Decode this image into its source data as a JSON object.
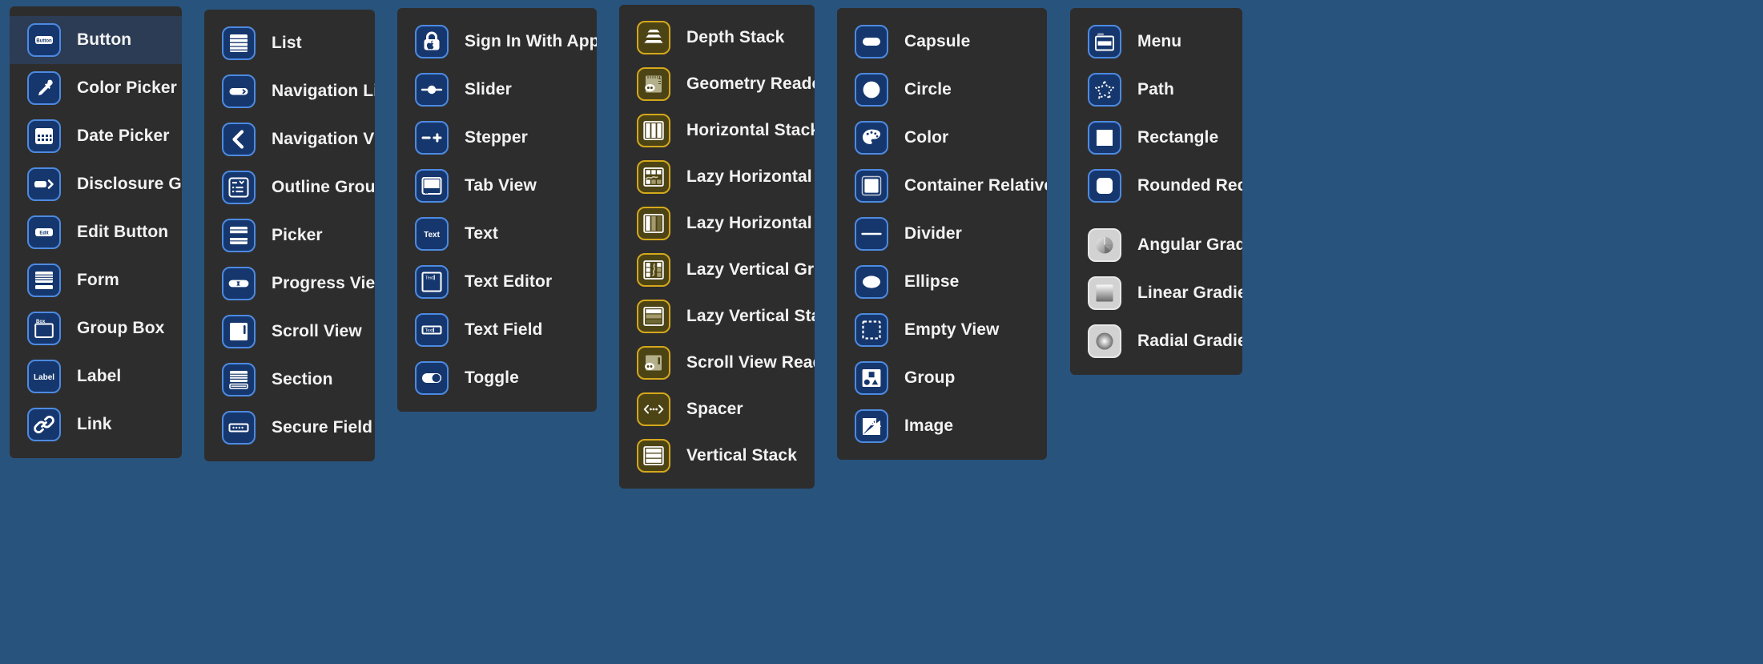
{
  "theme": {
    "page_background": "#28537d",
    "panel_background": "#2e2d2d",
    "selected_row_background": "#2c3c55",
    "label_color": "#f2f2f2",
    "icon_blue_fill": "#16376e",
    "icon_blue_border": "#4d8ae0",
    "icon_gold_fill": "#4d4416",
    "icon_gold_border": "#d4a81c",
    "icon_silver_fill": "#d2d2d2"
  },
  "panels": [
    {
      "id": "controls",
      "items": [
        {
          "label": "Button",
          "icon": "button-icon",
          "style": "blue",
          "selected": true
        },
        {
          "label": "Color Picker",
          "icon": "eyedropper-icon",
          "style": "blue",
          "selected": false
        },
        {
          "label": "Date Picker",
          "icon": "calendar-icon",
          "style": "blue",
          "selected": false
        },
        {
          "label": "Disclosure Group",
          "icon": "disclosure-icon",
          "style": "blue",
          "selected": false
        },
        {
          "label": "Edit Button",
          "icon": "edit-button-icon",
          "style": "blue",
          "selected": false
        },
        {
          "label": "Form",
          "icon": "form-icon",
          "style": "blue",
          "selected": false
        },
        {
          "label": "Group Box",
          "icon": "group-box-icon",
          "style": "blue",
          "selected": false
        },
        {
          "label": "Label",
          "icon": "label-icon",
          "style": "blue",
          "selected": false
        },
        {
          "label": "Link",
          "icon": "link-icon",
          "style": "blue",
          "selected": false
        }
      ]
    },
    {
      "id": "navigation",
      "items": [
        {
          "label": "List",
          "icon": "list-icon",
          "style": "blue",
          "selected": false
        },
        {
          "label": "Navigation Link",
          "icon": "navigation-link-icon",
          "style": "blue",
          "selected": false
        },
        {
          "label": "Navigation View",
          "icon": "chevron-left-icon",
          "style": "blue",
          "selected": false
        },
        {
          "label": "Outline Group",
          "icon": "outline-group-icon",
          "style": "blue",
          "selected": false
        },
        {
          "label": "Picker",
          "icon": "picker-icon",
          "style": "blue",
          "selected": false
        },
        {
          "label": "Progress View",
          "icon": "progress-view-icon",
          "style": "blue",
          "selected": false
        },
        {
          "label": "Scroll View",
          "icon": "scroll-view-icon",
          "style": "blue",
          "selected": false
        },
        {
          "label": "Section",
          "icon": "section-icon",
          "style": "blue",
          "selected": false
        },
        {
          "label": "Secure Field",
          "icon": "secure-field-icon",
          "style": "blue",
          "selected": false
        }
      ]
    },
    {
      "id": "inputs",
      "items": [
        {
          "label": "Sign In With Apple Button",
          "icon": "lock-apple-icon",
          "style": "blue",
          "selected": false
        },
        {
          "label": "Slider",
          "icon": "slider-icon",
          "style": "blue",
          "selected": false
        },
        {
          "label": "Stepper",
          "icon": "stepper-icon",
          "style": "blue",
          "selected": false
        },
        {
          "label": "Tab View",
          "icon": "tab-view-icon",
          "style": "blue",
          "selected": false
        },
        {
          "label": "Text",
          "icon": "text-icon",
          "style": "blue",
          "selected": false
        },
        {
          "label": "Text Editor",
          "icon": "text-editor-icon",
          "style": "blue",
          "selected": false
        },
        {
          "label": "Text Field",
          "icon": "text-field-icon",
          "style": "blue",
          "selected": false
        },
        {
          "label": "Toggle",
          "icon": "toggle-icon",
          "style": "blue",
          "selected": false
        }
      ]
    },
    {
      "id": "layout",
      "items": [
        {
          "label": "Depth Stack",
          "icon": "depth-stack-icon",
          "style": "gold",
          "selected": false
        },
        {
          "label": "Geometry Reader",
          "icon": "geometry-reader-icon",
          "style": "gold",
          "selected": false
        },
        {
          "label": "Horizontal Stack",
          "icon": "horizontal-stack-icon",
          "style": "gold",
          "selected": false
        },
        {
          "label": "Lazy Horizontal Grid",
          "icon": "lazy-horizontal-grid-icon",
          "style": "gold",
          "selected": false
        },
        {
          "label": "Lazy Horizontal Stack",
          "icon": "lazy-horizontal-stack-icon",
          "style": "gold",
          "selected": false
        },
        {
          "label": "Lazy Vertical Grid",
          "icon": "lazy-vertical-grid-icon",
          "style": "gold",
          "selected": false
        },
        {
          "label": "Lazy Vertical Stack",
          "icon": "lazy-vertical-stack-icon",
          "style": "gold",
          "selected": false
        },
        {
          "label": "Scroll View Reader",
          "icon": "scroll-view-reader-icon",
          "style": "gold",
          "selected": false
        },
        {
          "label": "Spacer",
          "icon": "spacer-icon",
          "style": "gold",
          "selected": false
        },
        {
          "label": "Vertical Stack",
          "icon": "vertical-stack-icon",
          "style": "gold",
          "selected": false
        }
      ]
    },
    {
      "id": "shapes",
      "items": [
        {
          "label": "Capsule",
          "icon": "capsule-icon",
          "style": "blue",
          "selected": false
        },
        {
          "label": "Circle",
          "icon": "circle-icon",
          "style": "blue",
          "selected": false
        },
        {
          "label": "Color",
          "icon": "palette-icon",
          "style": "blue",
          "selected": false
        },
        {
          "label": "Container Relative Shape",
          "icon": "container-shape-icon",
          "style": "blue",
          "selected": false
        },
        {
          "label": "Divider",
          "icon": "divider-icon",
          "style": "blue",
          "selected": false
        },
        {
          "label": "Ellipse",
          "icon": "ellipse-icon",
          "style": "blue",
          "selected": false
        },
        {
          "label": "Empty View",
          "icon": "empty-view-icon",
          "style": "blue",
          "selected": false
        },
        {
          "label": "Group",
          "icon": "group-icon",
          "style": "blue",
          "selected": false
        },
        {
          "label": "Image",
          "icon": "image-icon",
          "style": "blue",
          "selected": false
        }
      ]
    },
    {
      "id": "paths",
      "items": [
        {
          "label": "Menu",
          "icon": "menu-icon",
          "style": "blue",
          "selected": false
        },
        {
          "label": "Path",
          "icon": "star-path-icon",
          "style": "blue",
          "selected": false
        },
        {
          "label": "Rectangle",
          "icon": "rectangle-icon",
          "style": "blue",
          "selected": false
        },
        {
          "label": "Rounded Rectangle",
          "icon": "rounded-rectangle-icon",
          "style": "blue",
          "selected": false
        }
      ]
    },
    {
      "id": "gradients",
      "items": [
        {
          "label": "Angular Gradient",
          "icon": "angular-gradient-icon",
          "style": "silver",
          "selected": false
        },
        {
          "label": "Linear Gradient",
          "icon": "linear-gradient-icon",
          "style": "silver",
          "selected": false
        },
        {
          "label": "Radial Gradient",
          "icon": "radial-gradient-icon",
          "style": "silver",
          "selected": false
        }
      ]
    }
  ]
}
